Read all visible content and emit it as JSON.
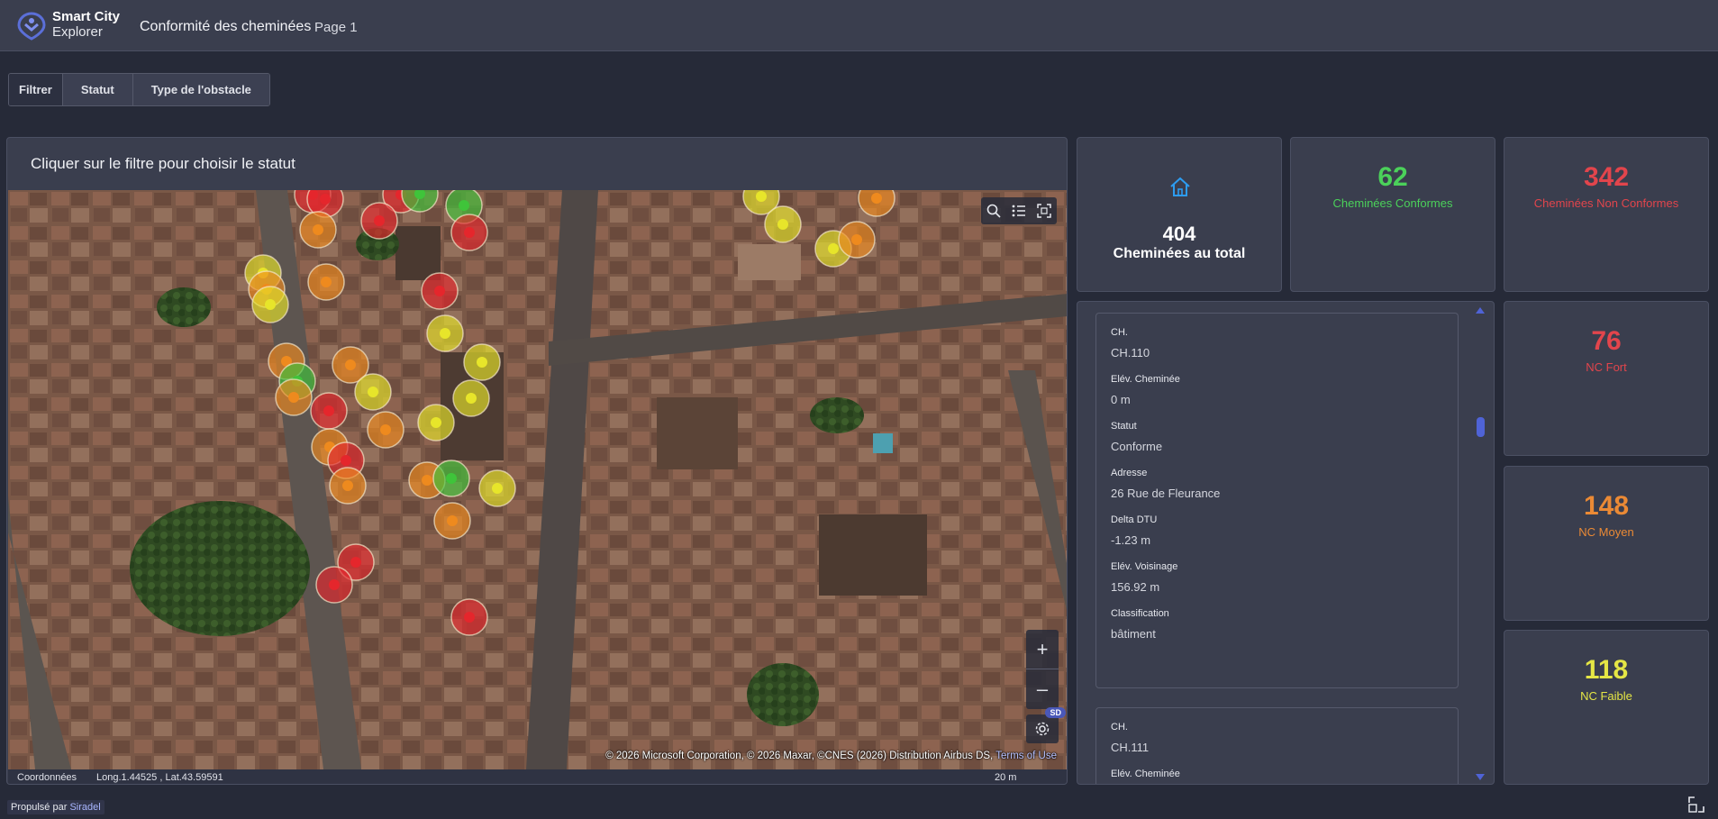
{
  "header": {
    "brand_line1": "Smart City",
    "brand_line2": "Explorer",
    "title": "Conformité des cheminées",
    "page": "Page 1"
  },
  "filters": {
    "items": [
      "Filtrer",
      "Statut",
      "Type de l'obstacle"
    ]
  },
  "map": {
    "caption": "Cliquer sur le filtre pour choisir le statut",
    "tools": [
      "search-icon",
      "legend-list-icon",
      "select-area-icon"
    ],
    "zoom_in": "+",
    "zoom_out": "–",
    "style_badge": "SD",
    "attribution": "© 2026 Microsoft Corporation, © 2026 Maxar, ©CNES (2026) Distribution Airbus DS,",
    "terms": "Terms of Use",
    "coords_label": "Coordonnées",
    "coords_value": "Long.1.44525 , Lat.43.59591",
    "scale": "20 m",
    "marker_colors": {
      "conforme": "#3fc43a",
      "nc_faible": "#e7e52a",
      "nc_moyen": "#ee8a1e",
      "nc_fort": "#e5262c"
    }
  },
  "kpis": {
    "total": {
      "value": "404",
      "label": "Cheminées au total",
      "icon": "house-icon"
    },
    "conformes": {
      "value": "62",
      "label": "Cheminées Conformes",
      "color": "#4bd15a"
    },
    "non_conformes": {
      "value": "342",
      "label": "Cheminées Non Conformes",
      "color": "#e2454c"
    },
    "nc_fort": {
      "value": "76",
      "label": "NC Fort",
      "color": "#e2454c"
    },
    "nc_moyen": {
      "value": "148",
      "label": "NC Moyen",
      "color": "#eb8a35"
    },
    "nc_faible": {
      "value": "118",
      "label": "NC Faible",
      "color": "#e5e645"
    }
  },
  "details": {
    "records": [
      {
        "ch_label": "CH.",
        "ch": "CH.110",
        "elev_label": "Elév. Cheminée",
        "elev": "0 m",
        "statut_label": "Statut",
        "statut": "Conforme",
        "adresse_label": "Adresse",
        "adresse": "26 Rue de Fleurance",
        "delta_label": "Delta DTU",
        "delta": "-1.23 m",
        "voisinage_label": "Elév. Voisinage",
        "voisinage": "156.92 m",
        "classification_label": "Classification",
        "classification": "bâtiment"
      },
      {
        "ch_label": "CH.",
        "ch": "CH.111",
        "elev_label": "Elév. Cheminée"
      }
    ]
  },
  "footer": {
    "powered": "Propulsé par",
    "vendor": "Siradel"
  }
}
